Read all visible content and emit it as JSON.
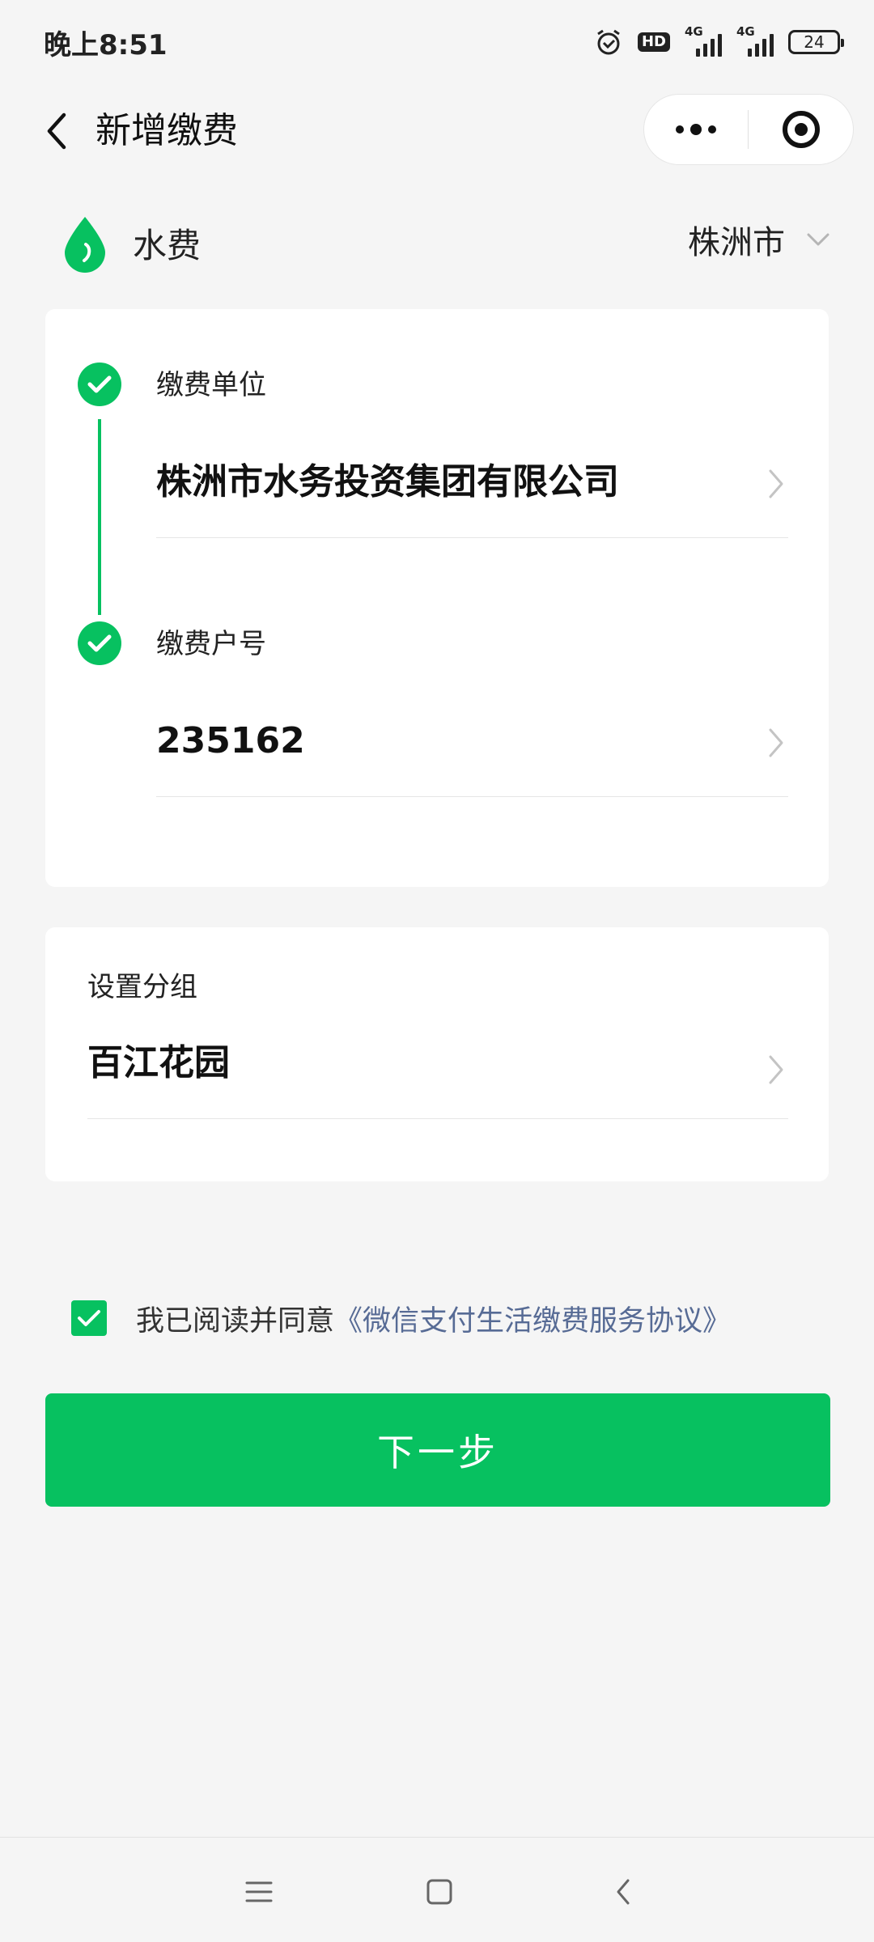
{
  "status_bar": {
    "time": "晚上8:51",
    "hd": "HD",
    "network_1": "4G",
    "network_2": "4G",
    "battery": "24"
  },
  "header": {
    "title": "新增缴费"
  },
  "category": {
    "label": "水费",
    "city": "株洲市"
  },
  "steps": [
    {
      "label": "缴费单位",
      "value": "株洲市水务投资集团有限公司"
    },
    {
      "label": "缴费户号",
      "value": "235162"
    }
  ],
  "group": {
    "label": "设置分组",
    "value": "百江花园"
  },
  "agreement": {
    "text": "我已阅读并同意",
    "link": "《微信支付生活缴费服务协议》"
  },
  "next_button": "下一步",
  "colors": {
    "accent": "#07c160",
    "link": "#576b95",
    "background": "#f5f5f5"
  }
}
